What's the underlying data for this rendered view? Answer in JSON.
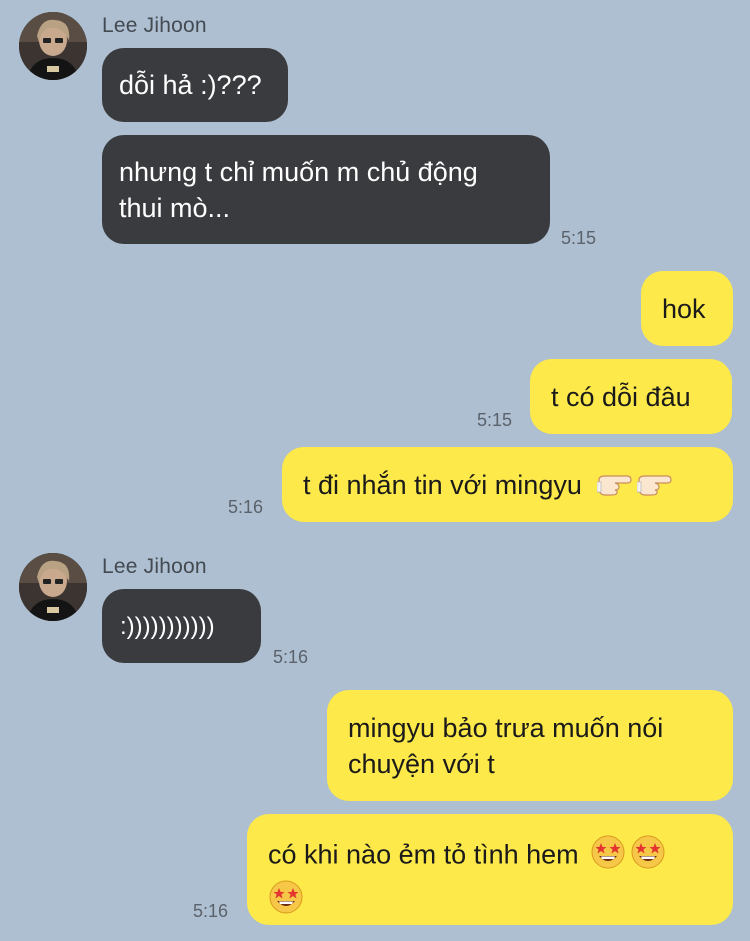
{
  "contact": {
    "name": "Lee Jihoon"
  },
  "messages": {
    "m1": {
      "text": "dỗi hả :)???"
    },
    "m2": {
      "line1": "nhưng t chỉ muốn m chủ động",
      "line2": "thui mò...",
      "time": "5:15"
    },
    "m3": {
      "text": "hok"
    },
    "m4": {
      "text": "t có dỗi đâu",
      "time": "5:15"
    },
    "m5": {
      "text": "t đi nhắn tin với mingyu",
      "emoji": [
        "backhand-index-pointing-right",
        "backhand-index-pointing-right"
      ],
      "time": "5:16"
    },
    "m6": {
      "text": ":)))))))))))",
      "time": "5:16"
    },
    "m7": {
      "line1": "mingyu bảo trưa muốn nói",
      "line2": "chuyện với t"
    },
    "m8": {
      "text": "có khi nào ẻm tỏ tình hem",
      "emoji": [
        "star-struck",
        "star-struck",
        "star-struck"
      ],
      "time": "5:16"
    }
  },
  "colors": {
    "background": "#adbfd1",
    "incoming_bubble": "#3a3b3f",
    "outgoing_bubble": "#fde94a",
    "timestamp": "#5b626b"
  },
  "icons": {
    "avatar": "profile-photo"
  }
}
